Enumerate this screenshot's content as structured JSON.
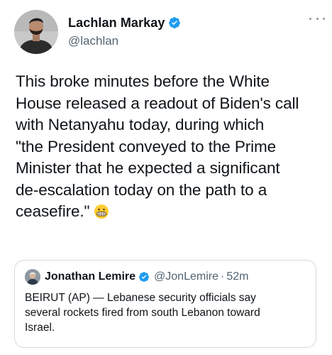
{
  "tweet": {
    "author": {
      "name": "Lachlan Markay",
      "handle": "@lachlan",
      "verified": true,
      "avatar": "profile-photo"
    },
    "more_icon": "more-horizontal-icon",
    "text_lines": [
      "This broke minutes before the White",
      "House released a readout of Biden's call",
      "with Netanyahu today, during which",
      "\"the President conveyed to the Prime",
      "Minister that he expected a significant",
      "de-escalation today on the path to a",
      "ceasefire.\""
    ],
    "emoji": "grimacing-face-icon"
  },
  "quote": {
    "author": {
      "name": "Jonathan Lemire",
      "handle": "@JonLemire",
      "verified": true
    },
    "separator": "·",
    "time": "52m",
    "text_lines": [
      "BEIRUT (AP) — Lebanese security officials say",
      "several rockets fired from south Lebanon toward",
      "Israel."
    ]
  },
  "colors": {
    "verified_blue": "#1d9bf0",
    "secondary_text": "#536471",
    "border": "#cfd9de"
  }
}
